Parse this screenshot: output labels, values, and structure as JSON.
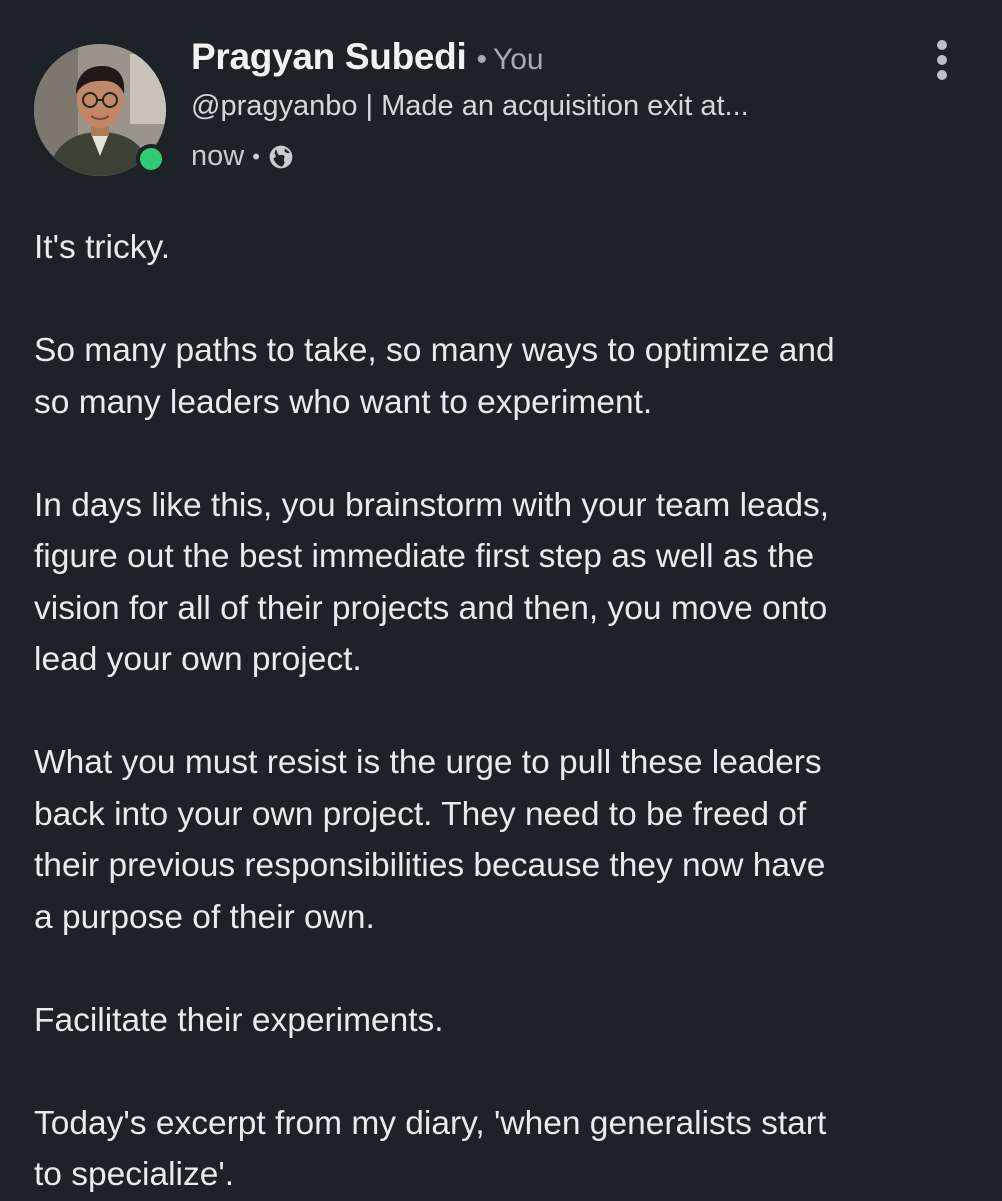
{
  "post": {
    "author": {
      "name": "Pragyan Subedi",
      "separator": "•",
      "relation": "You",
      "headline": "@pragyanbo | Made an acquisition exit at...",
      "online": true
    },
    "meta": {
      "time": "now",
      "separator": "•",
      "visibility_icon": "globe-icon"
    },
    "menu_icon": "more-vertical-icon",
    "paragraphs": [
      "It's tricky.",
      "So many paths to take, so many ways to optimize and\nso many leaders who want to experiment.",
      "In days like this, you brainstorm with your team leads,\nfigure out the best immediate first step as well as the\nvision for all of their projects and then, you move onto\nlead your own project.",
      "What you must resist is the urge to pull these leaders\nback into your own project. They need to be freed of\ntheir previous responsibilities because they now have\na purpose of their own.",
      "Facilitate their experiments.",
      "Today's excerpt from my diary, 'when generalists start\nto specialize'."
    ]
  },
  "colors": {
    "background": "#1d2226",
    "text": "#e9eaeb",
    "secondary_text": "#a8abad",
    "online_indicator": "#2fcc71"
  }
}
